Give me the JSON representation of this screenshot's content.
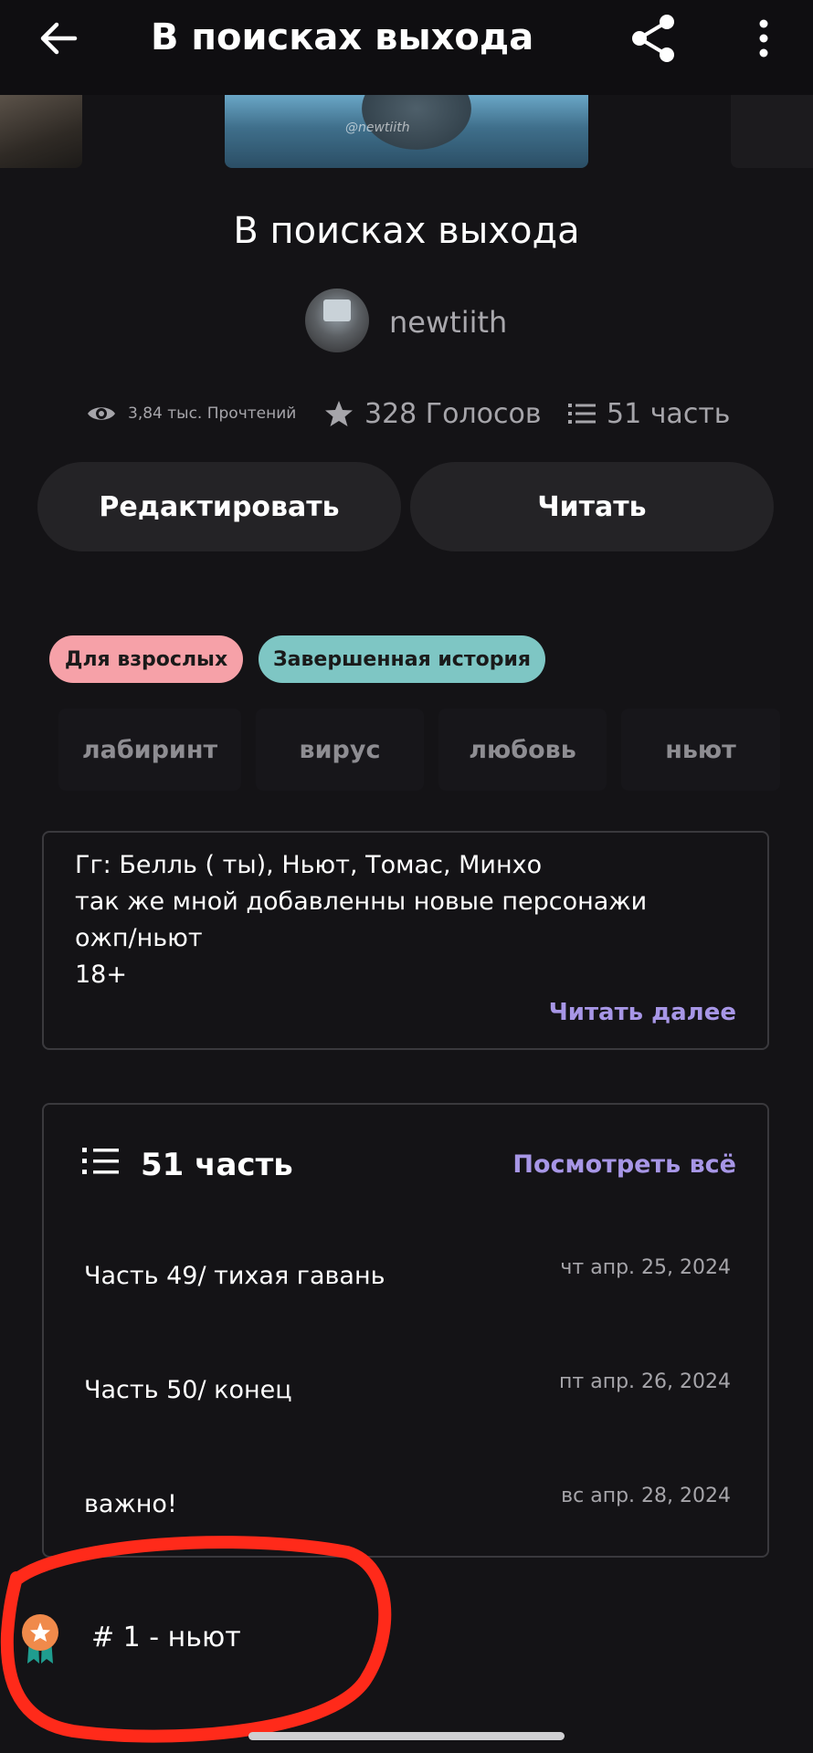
{
  "topbar": {
    "title": "В поисках выхода",
    "back_icon": "arrow-left-icon",
    "share_icon": "share-icon",
    "more_icon": "more-vertical-icon"
  },
  "story": {
    "title": "В поисках выхода",
    "author": "newtiith",
    "watermark": "@newtiith"
  },
  "stats": {
    "reads": "3,84 тыс. Прочтений",
    "votes": "328 Голосов",
    "parts": "51 часть"
  },
  "actions": {
    "edit_label": "Редактировать",
    "read_label": "Читать"
  },
  "badges": {
    "mature": "Для взрослых",
    "complete": "Завершенная история"
  },
  "tags": [
    "лабиринт",
    "вирус",
    "любовь",
    "ньют"
  ],
  "description": {
    "lines": [
      "Гг: Белль ( ты), Ньют, Томас, Минхо",
      "так же мной добавленны новые персонажи",
      "ожп/ньют",
      "18+"
    ],
    "read_more": "Читать далее"
  },
  "parts_section": {
    "title": "51 часть",
    "view_all": "Посмотреть всё",
    "items": [
      {
        "title": "Часть 49/ тихая гавань",
        "date": "чт апр. 25, 2024"
      },
      {
        "title": "Часть 50/ конец",
        "date": "пт апр. 26, 2024"
      },
      {
        "title": "важно!",
        "date": "вс апр. 28, 2024"
      }
    ]
  },
  "ranking": {
    "text": "# 1 - ньют",
    "icon": "award-ribbon-icon"
  },
  "colors": {
    "background": "#141316",
    "accent": "#a796e6",
    "mature_badge": "#f6a1a8",
    "complete_badge": "#7ec6c4",
    "annotation": "#ff2a1a"
  }
}
